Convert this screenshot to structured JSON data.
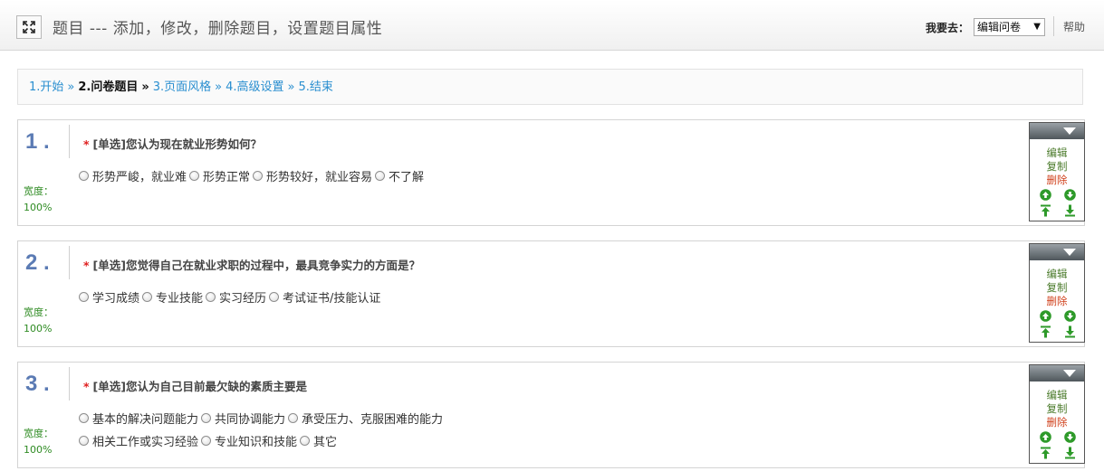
{
  "header": {
    "title": "题目 --- 添加，修改，删除题目，设置题目属性",
    "goto_label": "我要去：",
    "goto_selected": "编辑问卷",
    "help": "帮助"
  },
  "breadcrumb": {
    "steps": [
      "1.开始",
      "2.问卷题目",
      "3.页面风格",
      "4.高级设置",
      "5.结束"
    ],
    "separator": "»",
    "current_index": 1
  },
  "labels": {
    "required_mark": "*",
    "width_label": "宽度：",
    "edit": "编辑",
    "copy": "复制",
    "delete": "删除"
  },
  "questions": [
    {
      "num": "1 .",
      "title": "[单选]您认为现在就业形势如何？",
      "width_value": "100%",
      "option_lines": [
        [
          "形势严峻，就业难",
          "形势正常",
          "形势较好，就业容易",
          "不了解"
        ]
      ]
    },
    {
      "num": "2 .",
      "title": "[单选]您觉得自己在就业求职的过程中，最具竞争实力的方面是？",
      "width_value": "100%",
      "option_lines": [
        [
          "学习成绩",
          "专业技能",
          "实习经历",
          "考试证书/技能认证"
        ]
      ]
    },
    {
      "num": "3 .",
      "title": "[单选]您认为自己目前最欠缺的素质主要是",
      "width_value": "100%",
      "option_lines": [
        [
          "基本的解决问题能力",
          "共同协调能力",
          "承受压力、克服困难的能力"
        ],
        [
          "相关工作或实习经验",
          "专业知识和技能",
          "其它"
        ]
      ]
    }
  ],
  "colors": {
    "link": "#2a8fd0",
    "question_number": "#5b7bb4",
    "width_text": "#2e8b22",
    "delete": "#d0401b",
    "required": "#e02020"
  }
}
